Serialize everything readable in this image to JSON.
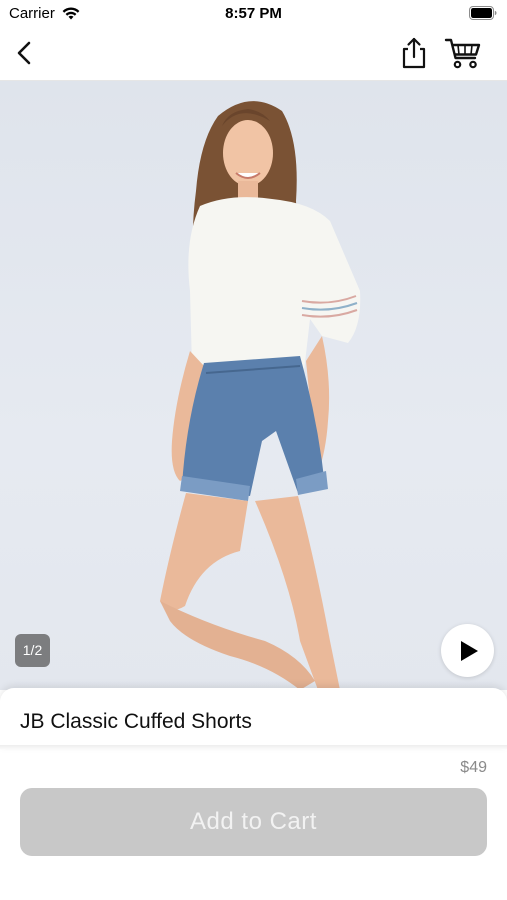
{
  "status_bar": {
    "carrier": "Carrier",
    "time": "8:57 PM"
  },
  "nav": {
    "back_icon": "chevron-left-icon",
    "share_icon": "share-icon",
    "cart_icon": "cart-icon"
  },
  "gallery": {
    "page_indicator": "1/2",
    "play_icon": "play-icon",
    "background_color": "#e3e7ee"
  },
  "product": {
    "title": "JB Classic Cuffed Shorts",
    "price": "$49"
  },
  "actions": {
    "add_to_cart_label": "Add to Cart",
    "add_to_cart_color": "#c8c8c8"
  }
}
